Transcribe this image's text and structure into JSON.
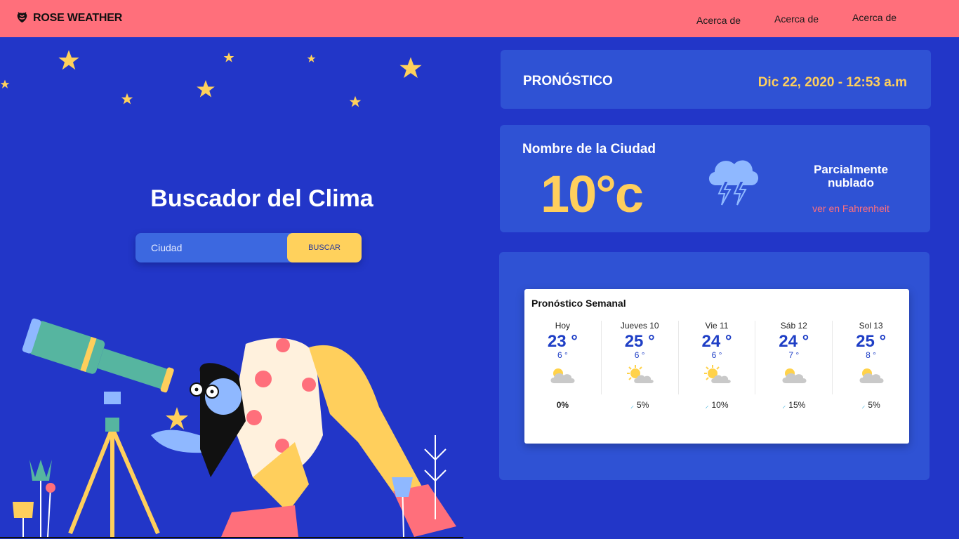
{
  "nav": {
    "brand": "ROSE WEATHER",
    "links": [
      "Acerca de",
      "Acerca de",
      "Acerca de"
    ]
  },
  "hero": {
    "title": "Buscador del Clima",
    "search_placeholder": "Ciudad",
    "search_button": "BUSCAR"
  },
  "forecast": {
    "title": "PRONÓSTICO",
    "datetime": "Dic 22, 2020 - 12:53 a.m"
  },
  "current": {
    "city": "Nombre de la Ciudad",
    "temperature": "10°c",
    "condition": "Parcialmente nublado",
    "fahrenheit_link": "ver en Fahrenheit",
    "icon": "storm-cloud-icon"
  },
  "weekly": {
    "title": "Pronóstico Semanal",
    "days": [
      {
        "name": "Hoy",
        "max": "23 °",
        "min": "6 °",
        "icon": "cloudy-sun-icon",
        "rain": "0%"
      },
      {
        "name": "Jueves 10",
        "max": "25 °",
        "min": "6 °",
        "icon": "sunny-cloud-icon",
        "rain": "5%"
      },
      {
        "name": "Vie 11",
        "max": "24 °",
        "min": "6 °",
        "icon": "sunny-cloud-icon",
        "rain": "10%"
      },
      {
        "name": "Sáb 12",
        "max": "24 °",
        "min": "7 °",
        "icon": "cloudy-sun-icon",
        "rain": "15%"
      },
      {
        "name": "Sol 13",
        "max": "25 °",
        "min": "8 °",
        "icon": "cloudy-sun-icon",
        "rain": "5%"
      }
    ]
  },
  "colors": {
    "background": "#2236c8",
    "nav": "#ff6f7b",
    "card": "#2f52d4",
    "accent_yellow": "#ffcf5c",
    "accent_pink": "#ff6f7b"
  }
}
